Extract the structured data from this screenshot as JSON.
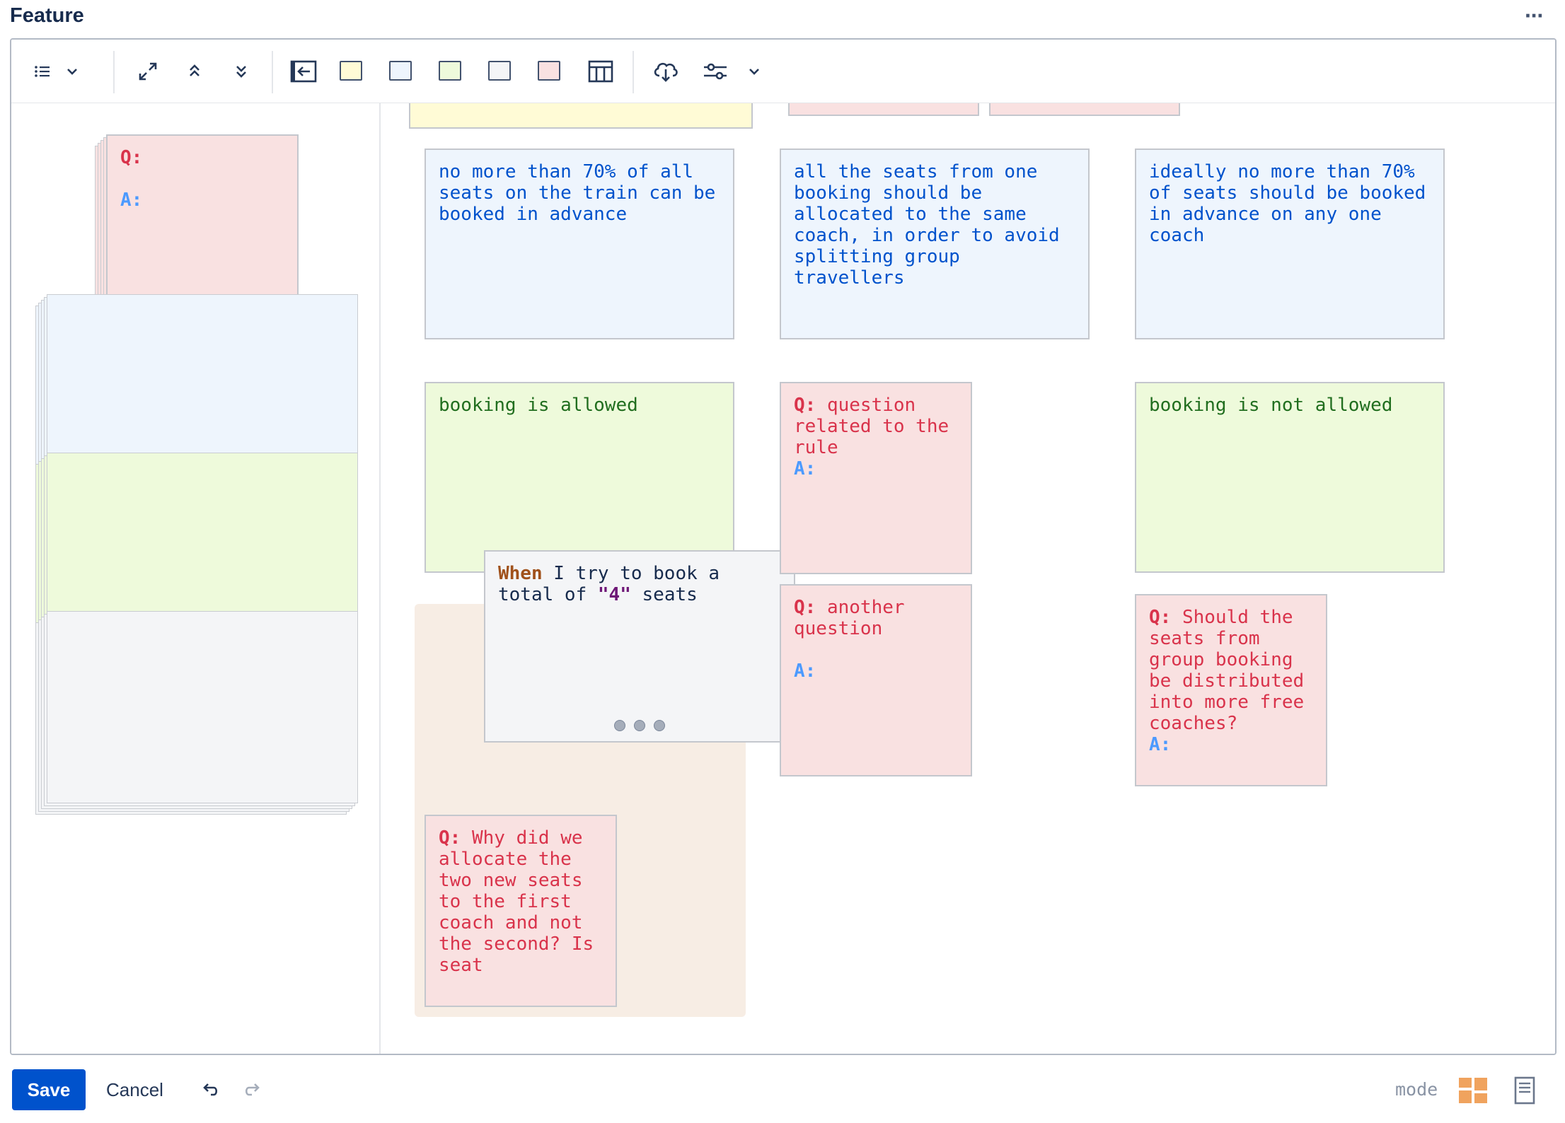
{
  "header": {
    "title": "Feature",
    "more_icon": "more-horizontal-icon"
  },
  "toolbar": {
    "groups": [
      [
        "list-icon",
        "chevron-down-icon"
      ],
      [
        "expand-icon",
        "collapse-up-icon",
        "expand-down-icon"
      ],
      [
        "back-to-panel-icon",
        "yellow-swatch",
        "blue-swatch",
        "green-swatch",
        "grey-swatch",
        "pink-swatch",
        "table-icon"
      ],
      [
        "cloud-download-icon",
        "settings-sliders-icon",
        "chevron-down-icon"
      ]
    ],
    "swatch_colors": {
      "yellow": "#fffbd6",
      "blue": "#eef5fd",
      "green": "#eefadb",
      "grey": "#f4f5f7",
      "pink": "#f9e1e1"
    }
  },
  "palette": {
    "question_template": {
      "q": "Q:",
      "a": "A:"
    }
  },
  "cards": {
    "rule1": "no more than 70% of all seats on the train can be booked in advance",
    "rule2": "all the seats from one booking should be allocated to the same coach, in order to avoid splitting group travellers",
    "rule3": "ideally no more than 70% of seats should be booked in advance on any one coach",
    "example1": "booking is allowed",
    "example3": "booking is not allowed",
    "q1": {
      "q": "Q:",
      "text": " question related to the rule",
      "a": "A:"
    },
    "q2": {
      "q": "Q:",
      "text": " another question",
      "a": "A:"
    },
    "q3": {
      "q": "Q:",
      "text": " Should the seats from group booking be distributed into more free coaches?",
      "a": "A:"
    },
    "q4": {
      "q": "Q:",
      "text": " Why did we allocate the two new seats to the first coach and not the second? Is seat"
    },
    "step": {
      "keyword": "When",
      "text1": " I try to book a total of ",
      "value": "\"4\"",
      "text2": " seats"
    }
  },
  "footer": {
    "save": "Save",
    "cancel": "Cancel",
    "undo_icon": "undo-icon",
    "redo_icon": "redo-icon",
    "mode_label": "mode",
    "mode_icons": [
      "board-mode-icon",
      "document-mode-icon"
    ],
    "accent": "#0052cc"
  }
}
